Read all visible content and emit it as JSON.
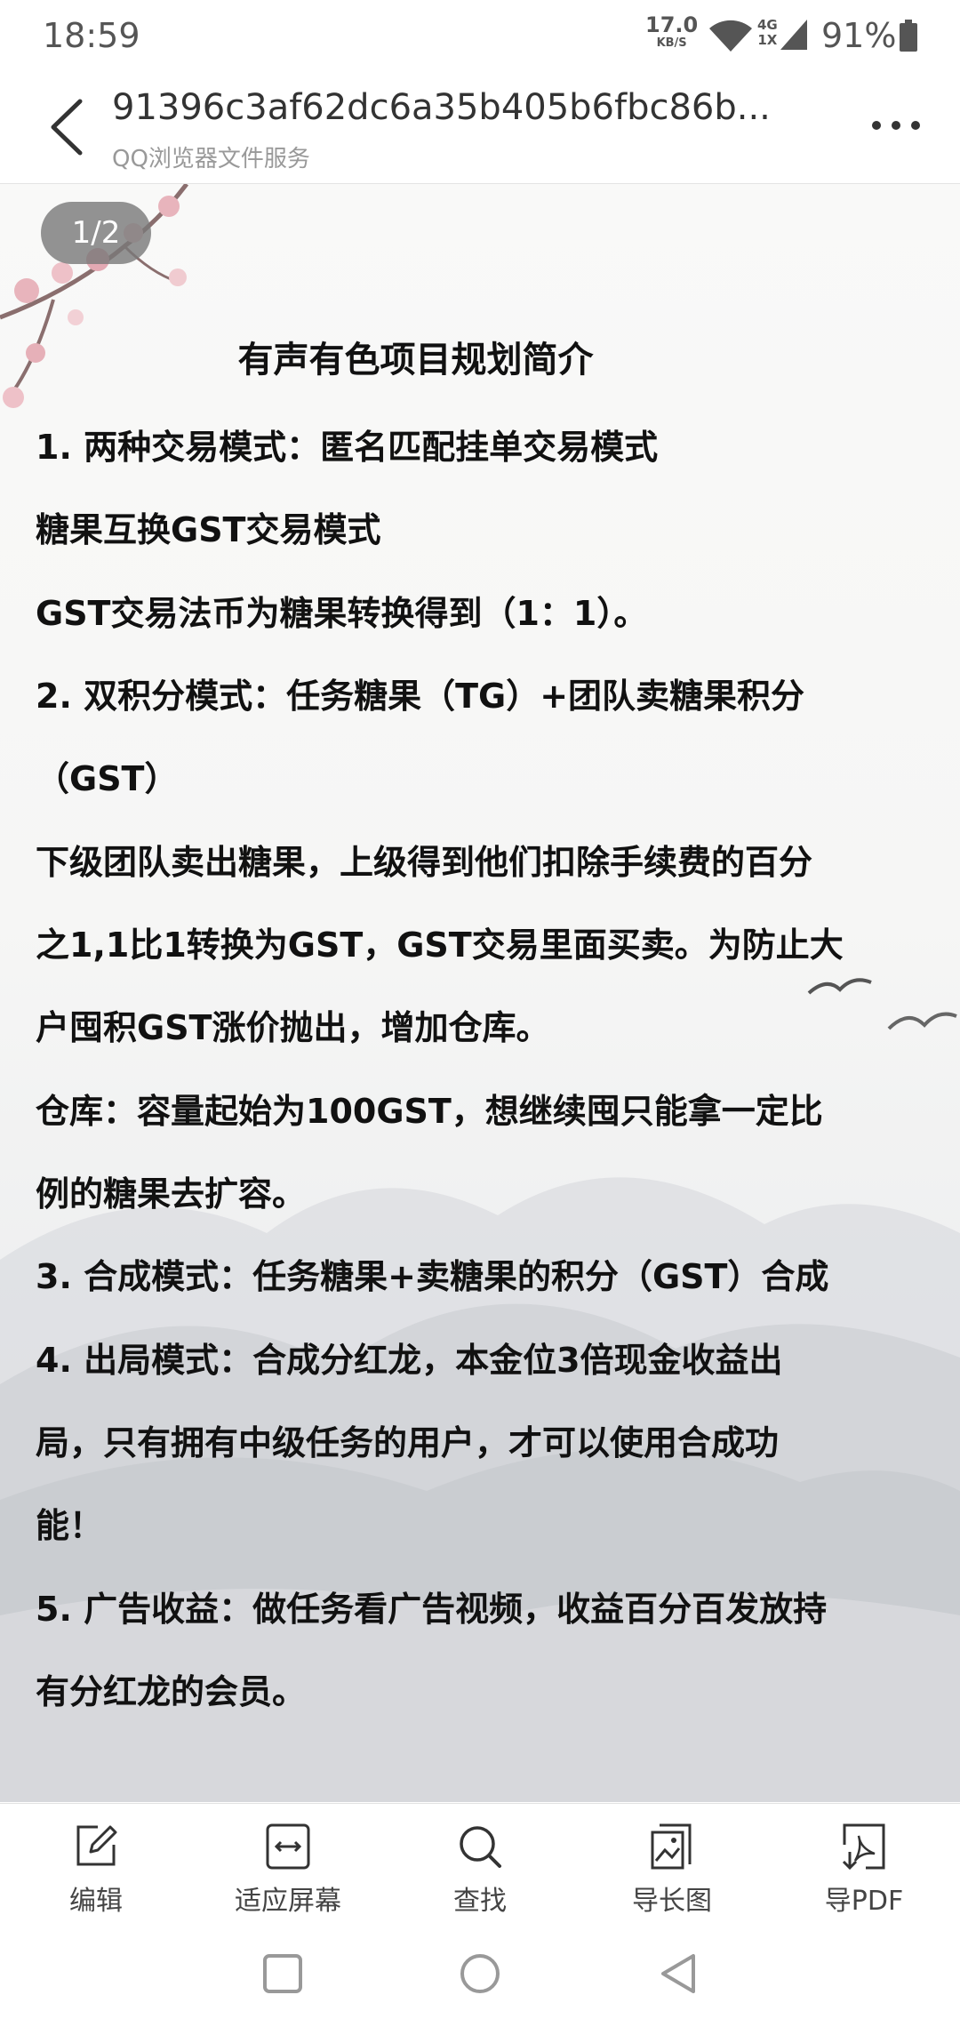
{
  "status_bar": {
    "time": "18:59",
    "net_speed": "17.0",
    "net_speed_unit": "KB/S",
    "signal_type": "4G",
    "signal_sub": "1X",
    "battery": "91%"
  },
  "header": {
    "title": "91396c3af62dc6a35b405b6fbc86b...",
    "subtitle": "QQ浏览器文件服务"
  },
  "document": {
    "page_indicator": "1/2",
    "heading": "有声有色项目规划简介",
    "lines": [
      "1. 两种交易模式：匿名匹配挂单交易模式",
      "糖果互换GST交易模式",
      "GST交易法币为糖果转换得到（1：1）。",
      "2. 双积分模式：任务糖果（TG）+团队卖糖果积分",
      "（GST）",
      "下级团队卖出糖果，上级得到他们扣除手续费的百分",
      "之1,1比1转换为GST，GST交易里面买卖。为防止大",
      "户囤积GST涨价抛出，增加仓库。",
      "仓库：容量起始为100GST，想继续囤只能拿一定比",
      "例的糖果去扩容。",
      "3. 合成模式：任务糖果+卖糖果的积分（GST）合成",
      "4. 出局模式：合成分红龙，本金位3倍现金收益出",
      "局，只有拥有中级任务的用户，才可以使用合成功",
      "能！",
      "5. 广告收益：做任务看广告视频，收益百分百发放持",
      "有分红龙的会员。"
    ]
  },
  "toolbar": {
    "edit": "编辑",
    "fit_screen": "适应屏幕",
    "find": "查找",
    "export_long_image": "导长图",
    "export_pdf": "导PDF"
  },
  "icons": {
    "back": "back-arrow-icon",
    "more": "more-icon",
    "edit": "edit-icon",
    "fit": "fit-screen-icon",
    "find": "search-icon",
    "long_image": "long-image-icon",
    "pdf": "pdf-icon"
  }
}
